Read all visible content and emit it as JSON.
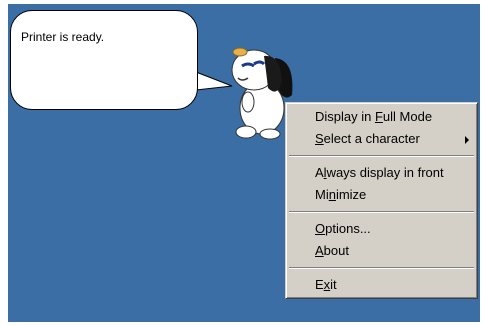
{
  "balloon": {
    "message": "Printer is ready."
  },
  "menu": {
    "full_mode": {
      "before": "Display in ",
      "key": "F",
      "after": "ull Mode"
    },
    "select_character": {
      "before": "",
      "key": "S",
      "after": "elect a character"
    },
    "always_front": {
      "before": "A",
      "key": "l",
      "after": "ways display in front"
    },
    "minimize": {
      "before": "Mi",
      "key": "n",
      "after": "imize"
    },
    "options": {
      "before": "",
      "key": "O",
      "after": "ptions..."
    },
    "about": {
      "before": "",
      "key": "A",
      "after": "bout"
    },
    "exit": {
      "before": "E",
      "key": "x",
      "after": "it"
    }
  },
  "colors": {
    "desktop": "#3a6ea5",
    "menu_face": "#d4d0c8"
  },
  "icons": {
    "character": "dog-mascot-icon",
    "submenu": "submenu-arrow-icon"
  }
}
